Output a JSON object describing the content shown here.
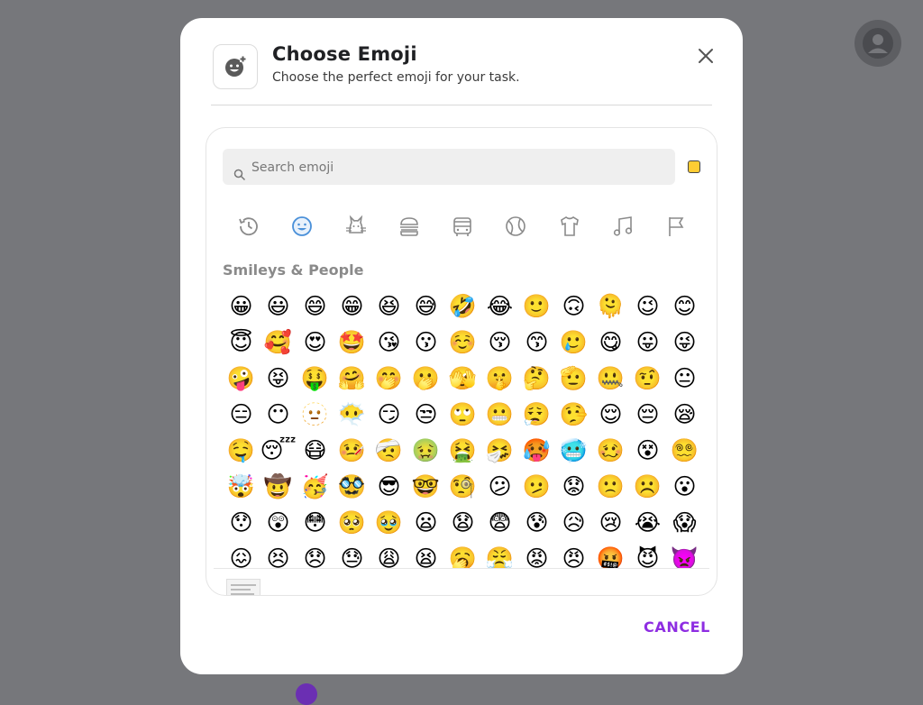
{
  "dialog": {
    "title": "Choose Emoji",
    "subtitle": "Choose the perfect emoji for your task.",
    "cancel_label": "CANCEL"
  },
  "search": {
    "placeholder": "Search emoji",
    "value": ""
  },
  "skin_tone_color": "#ffcc33",
  "categories": [
    {
      "name": "recent",
      "icon": "history-icon",
      "active": false
    },
    {
      "name": "smileys",
      "icon": "smiley-icon",
      "active": true
    },
    {
      "name": "animals",
      "icon": "cat-icon",
      "active": false
    },
    {
      "name": "food",
      "icon": "burger-icon",
      "active": false
    },
    {
      "name": "travel",
      "icon": "bus-icon",
      "active": false
    },
    {
      "name": "activities",
      "icon": "ball-icon",
      "active": false
    },
    {
      "name": "objects",
      "icon": "shirt-icon",
      "active": false
    },
    {
      "name": "symbols",
      "icon": "music-note-icon",
      "active": false
    },
    {
      "name": "flags",
      "icon": "flag-icon",
      "active": false
    }
  ],
  "section_title": "Smileys & People",
  "emojis": [
    "😀",
    "😃",
    "😄",
    "😁",
    "😆",
    "😅",
    "🤣",
    "😂",
    "🙂",
    "🙃",
    "🫠",
    "😉",
    "😊",
    "😇",
    "🥰",
    "😍",
    "🤩",
    "😘",
    "😗",
    "☺️",
    "😚",
    "😙",
    "🥲",
    "😋",
    "😛",
    "😜",
    "🤪",
    "😝",
    "🤑",
    "🤗",
    "🤭",
    "🫢",
    "🫣",
    "🤫",
    "🤔",
    "🫡",
    "🤐",
    "🤨",
    "😐",
    "😑",
    "😶",
    "🫥",
    "😶‍🌫️",
    "😏",
    "😒",
    "🙄",
    "😬",
    "😮‍💨",
    "🤥",
    "😌",
    "😔",
    "😪",
    "🤤",
    "😴",
    "😷",
    "🤒",
    "🤕",
    "🤢",
    "🤮",
    "🤧",
    "🥵",
    "🥶",
    "🥴",
    "😵",
    "😵‍💫",
    "🤯",
    "🤠",
    "🥳",
    "🥸",
    "😎",
    "🤓",
    "🧐",
    "😕",
    "🫤",
    "😟",
    "🙁",
    "☹️",
    "😮",
    "😯",
    "😲",
    "😳",
    "🥺",
    "🥹",
    "😦",
    "😧",
    "😨",
    "😰",
    "😥",
    "😢",
    "😭",
    "😱",
    "😖",
    "😣",
    "😞",
    "😓",
    "😩",
    "😫",
    "🥱",
    "😤",
    "😡",
    "😠",
    "🤬",
    "😈",
    "👿"
  ],
  "colors": {
    "accent": "#8e2de2",
    "active_category": "#4a90d9"
  }
}
